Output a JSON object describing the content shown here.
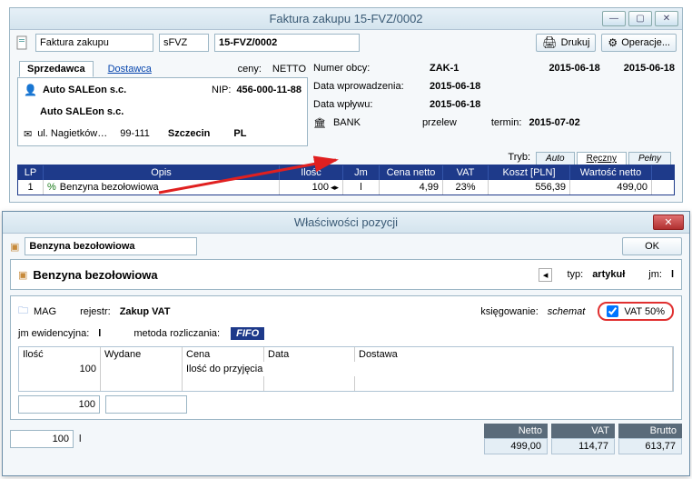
{
  "win1": {
    "title": "Faktura zakupu 15-FVZ/0002",
    "doc_type": "Faktura zakupu",
    "code": "sFVZ",
    "number": "15-FVZ/0002",
    "btn_print": "Drukuj",
    "btn_ops": "Operacje...",
    "tab_seller": "Sprzedawca",
    "tab_supplier": "Dostawca",
    "ceny_label": "ceny:",
    "ceny_value": "NETTO",
    "seller_name": "Auto SALEon s.c.",
    "nip_label": "NIP:",
    "nip_value": "456-000-11-88",
    "seller_name2": "Auto SALEon s.c.",
    "addr_street": "ul. Nagietków…",
    "addr_code": "99-111",
    "addr_city": "Szczecin",
    "addr_country": "PL",
    "numer_obcy_label": "Numer obcy:",
    "numer_obcy_value": "ZAK-1",
    "date1": "2015-06-18",
    "date2": "2015-06-18",
    "data_wpr_label": "Data wprowadzenia:",
    "data_wpr_value": "2015-06-18",
    "data_wpl_label": "Data wpływu:",
    "data_wpl_value": "2015-06-18",
    "bank_label": "BANK",
    "przelew": "przelew",
    "termin_label": "termin:",
    "termin_value": "2015-07-02",
    "tryb_label": "Tryb:",
    "tryb_auto": "Auto",
    "tryb_reczny": "Ręczny",
    "tryb_pelny": "Pełny",
    "grid": {
      "h_lp": "LP",
      "h_opis": "Opis",
      "h_ilosc": "Ilość",
      "h_jm": "Jm",
      "h_cena": "Cena netto",
      "h_vat": "VAT",
      "h_koszt": "Koszt [PLN]",
      "h_wart": "Wartość netto",
      "r1_lp": "1",
      "r1_opis": "Benzyna bezołowiowa",
      "r1_ilosc": "100",
      "r1_jm": "l",
      "r1_cena": "4,99",
      "r1_vat": "23%",
      "r1_koszt": "556,39",
      "r1_wart": "499,00"
    }
  },
  "win2": {
    "title": "Właściwości pozycji",
    "item_name": "Benzyna bezołowiowa",
    "btn_ok": "OK",
    "item_name2": "Benzyna bezołowiowa",
    "typ_label": "typ:",
    "typ_value": "artykuł",
    "jm_label": "jm:",
    "jm_value": "l",
    "mag": "MAG",
    "rejestr_label": "rejestr:",
    "rejestr_value": "Zakup VAT",
    "ksieg_label": "księgowanie:",
    "ksieg_value": "schemat",
    "vat50_label": "VAT 50%",
    "jm_ewid_label": "jm ewidencyjna:",
    "jm_ewid_value": "l",
    "metoda_label": "metoda rozliczania:",
    "metoda_value": "FIFO",
    "t2_h_ilosc": "Ilość",
    "t2_h_wydane": "Wydane",
    "t2_h_cena": "Cena",
    "t2_h_data": "Data",
    "t2_h_dostawa": "Dostawa",
    "t2_r_ilosc": "100",
    "t2_ilosc_do_przyj": "Ilość do przyjęcia",
    "sum_h_netto": "Netto",
    "sum_h_vat": "VAT",
    "sum_h_brutto": "Brutto",
    "sum_v_netto": "499,00",
    "sum_v_vat": "114,77",
    "sum_v_brutto": "613,77",
    "bottom_qty": "100",
    "bottom_jm": "l"
  }
}
